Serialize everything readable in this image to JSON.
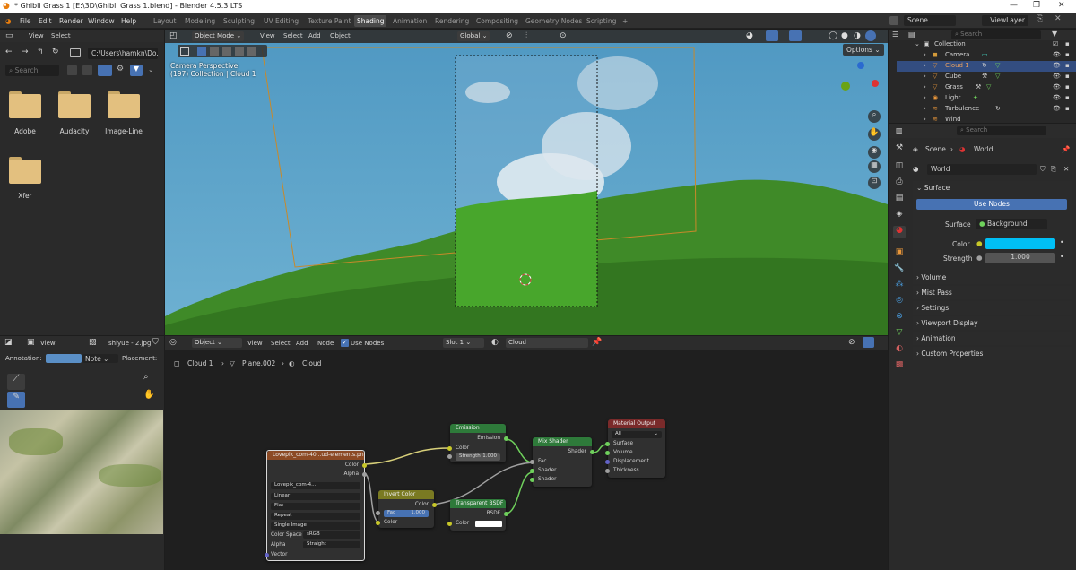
{
  "window": {
    "title": "* Ghibli Grass 1 [E:\\3D\\Ghibli Grass 1.blend] - Blender 4.5.3 LTS",
    "controls": [
      "—",
      "❐",
      "✕"
    ]
  },
  "menu": [
    "File",
    "Edit",
    "Render",
    "Window",
    "Help"
  ],
  "workspaces": [
    "Layout",
    "Modeling",
    "Sculpting",
    "UV Editing",
    "Texture Paint",
    "Shading",
    "Animation",
    "Rendering",
    "Compositing",
    "Geometry Nodes",
    "Scripting",
    "+"
  ],
  "scene": {
    "name": "Scene",
    "view_layer": "ViewLayer"
  },
  "file_browser": {
    "view": "View",
    "select": "Select",
    "path": "C:\\Users\\hamkn\\Do...",
    "search_placeholder": "Search",
    "folders": [
      "Adobe",
      "Audacity",
      "Image-Line",
      "Xfer"
    ]
  },
  "viewport": {
    "mode": "Object Mode",
    "menus": [
      "View",
      "Select",
      "Add",
      "Object"
    ],
    "orientation": "Global",
    "options": "Options",
    "info_line1": "Camera Perspective",
    "info_line2": "(197) Collection | Cloud 1",
    "colors": {
      "sky": "#5b9fc4",
      "grass": "#3f8a28",
      "camera_border": "#c8892a"
    }
  },
  "image_editor": {
    "view": "View",
    "image_name": "shiyue - 2.jpg",
    "annotation_label": "Annotation:",
    "annotation_mode": "Note",
    "placement_label": "Placement:"
  },
  "node_editor": {
    "type": "Object",
    "menus": [
      "View",
      "Select",
      "Add",
      "Node"
    ],
    "use_nodes": "Use Nodes",
    "slot": "Slot 1",
    "material": "Cloud",
    "breadcrumb": [
      "Cloud 1",
      "Plane.002",
      "Cloud"
    ],
    "nodes": {
      "image": {
        "title": "Lovepik_com-40...ud-elements.png",
        "out_color": "Color",
        "out_alpha": "Alpha",
        "image": "Lovepik_com-4...",
        "interpolation": "Linear",
        "projection": "Flat",
        "extension": "Repeat",
        "source": "Single Image",
        "colorspace_label": "Color Space",
        "colorspace": "sRGB",
        "alpha_label": "Alpha",
        "alpha": "Straight",
        "in_vector": "Vector"
      },
      "emission": {
        "title": "Emission",
        "out": "Emission",
        "in_color": "Color",
        "strength_label": "Strength",
        "strength": "1.000"
      },
      "invert": {
        "title": "Invert Color",
        "out": "Color",
        "fac_label": "Fac",
        "fac": "1.000",
        "in_color": "Color"
      },
      "transparent": {
        "title": "Transparent BSDF",
        "out": "BSDF",
        "in_color": "Color"
      },
      "mix": {
        "title": "Mix Shader",
        "out": "Shader",
        "fac": "Fac",
        "s1": "Shader",
        "s2": "Shader"
      },
      "output": {
        "title": "Material Output",
        "target": "All",
        "surface": "Surface",
        "volume": "Volume",
        "displacement": "Displacement",
        "thickness": "Thickness"
      }
    }
  },
  "outliner": {
    "search_placeholder": "Search",
    "root": "Collection",
    "items": [
      "Camera",
      "Cloud 1",
      "Cube",
      "Grass",
      "Light",
      "Turbulence",
      "Wind"
    ]
  },
  "properties": {
    "search_placeholder": "Search",
    "breadcrumb": [
      "Scene",
      "World"
    ],
    "world_name": "World",
    "surface_section": "Surface",
    "use_nodes": "Use Nodes",
    "surface_label": "Surface",
    "surface_value": "Background",
    "color_label": "Color",
    "color_value": "#00bff5",
    "strength_label": "Strength",
    "strength_value": "1.000",
    "sections": [
      "Volume",
      "Mist Pass",
      "Settings",
      "Viewport Display",
      "Animation",
      "Custom Properties"
    ]
  }
}
